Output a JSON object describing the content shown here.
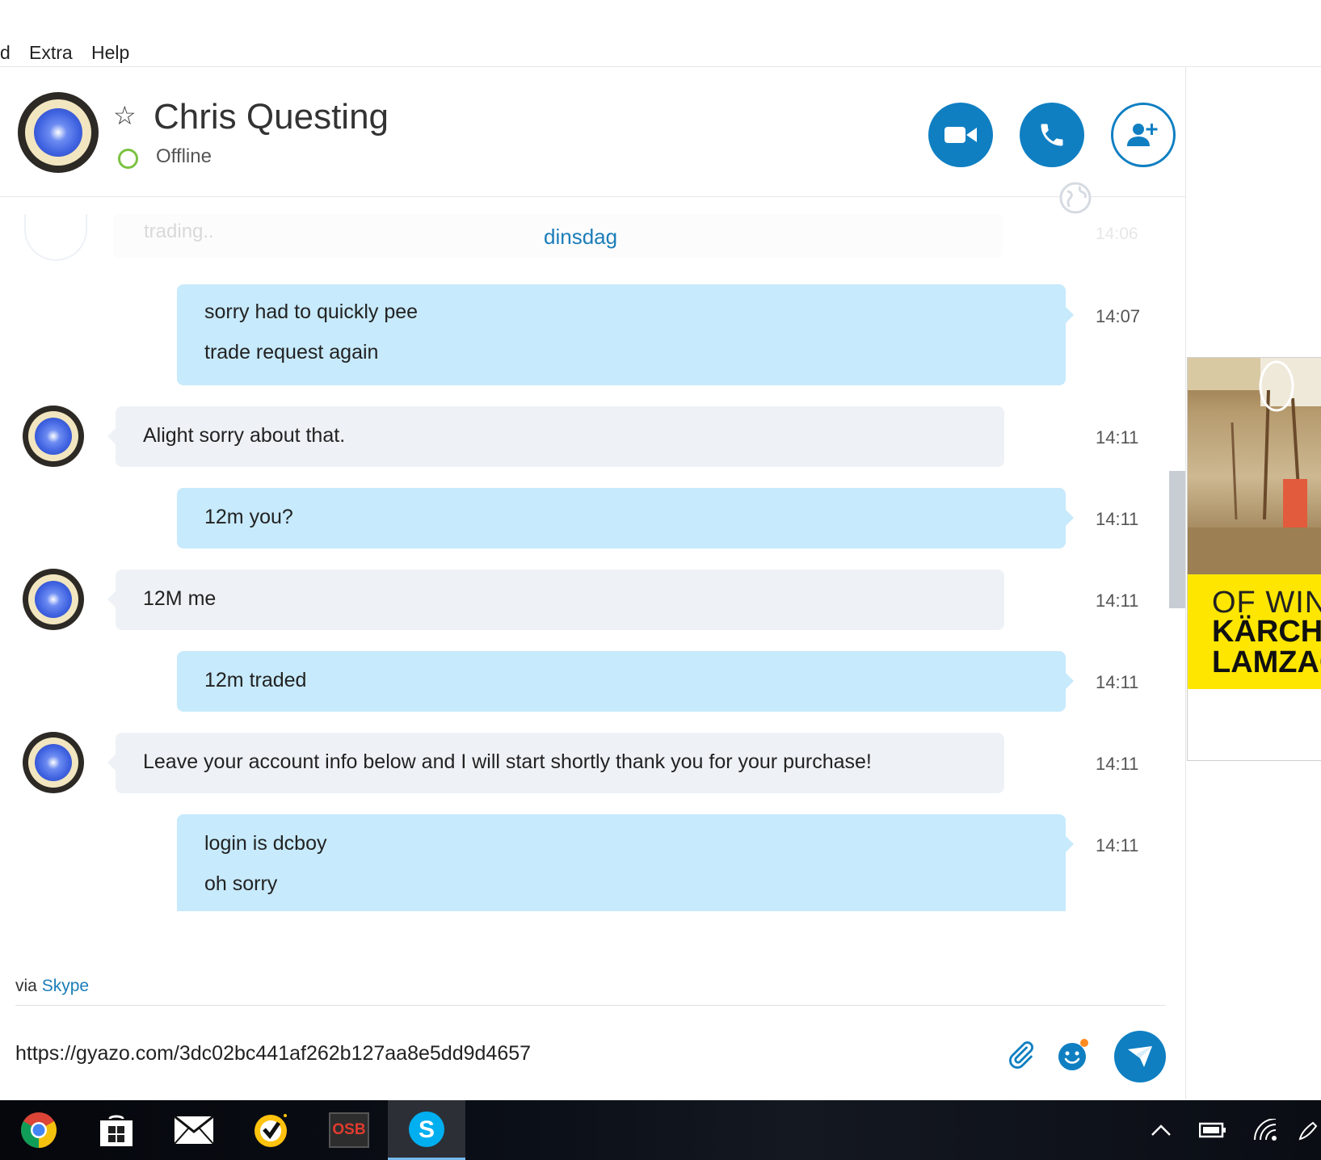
{
  "menu": {
    "items": [
      "d",
      "Extra",
      "Help"
    ]
  },
  "header": {
    "contact_name": "Chris Questing",
    "status": "Offline",
    "status_color": "#7cc242",
    "buttons": {
      "video": "video-call",
      "call": "audio-call",
      "add_people": "add-people"
    }
  },
  "conversation": {
    "faded_message": {
      "text": "trading..",
      "time": "14:06"
    },
    "date_separator": "dinsdag",
    "messages": [
      {
        "sender": "me",
        "lines": [
          "sorry had to quickly pee",
          "trade request again"
        ],
        "time": "14:07"
      },
      {
        "sender": "contact",
        "lines": [
          "Alight sorry about that."
        ],
        "time": "14:11"
      },
      {
        "sender": "me",
        "lines": [
          "12m you?"
        ],
        "time": "14:11"
      },
      {
        "sender": "contact",
        "lines": [
          "12M me"
        ],
        "time": "14:11"
      },
      {
        "sender": "me",
        "lines": [
          "12m traded"
        ],
        "time": "14:11"
      },
      {
        "sender": "contact",
        "lines": [
          "Leave your account info below and I will start shortly thank you for your purchase!"
        ],
        "time": "14:11"
      },
      {
        "sender": "me",
        "lines": [
          "login is dcboy",
          "oh sorry"
        ],
        "time": "14:11"
      }
    ]
  },
  "footer": {
    "via_prefix": "via",
    "via_link": "Skype",
    "compose_value": "https://gyazo.com/3dc02bc441af262b127aa8e5dd9d4657"
  },
  "ad": {
    "line1": "OF WIN",
    "line2": "KÄRCHE",
    "line3": "LAMZAC"
  },
  "colors": {
    "accent": "#0f7fc2",
    "my_bubble": "#c7eafc",
    "their_bubble": "#eef2f6",
    "link": "#1a7db8"
  },
  "taskbar": {
    "apps": [
      "chrome-icon",
      "store-icon",
      "mail-icon",
      "norton-icon",
      "osb-icon",
      "skype-icon"
    ],
    "osb_label": "OSB"
  }
}
